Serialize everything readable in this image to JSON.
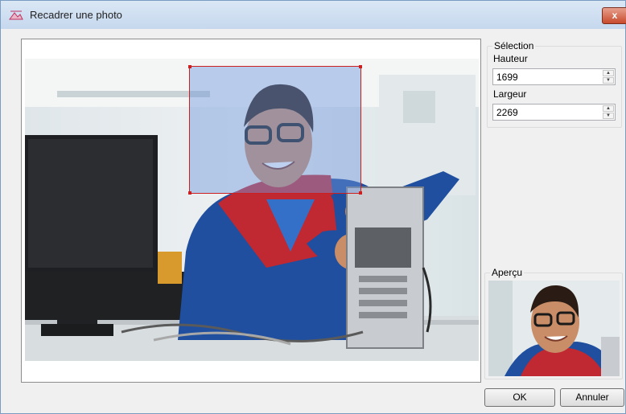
{
  "window": {
    "title": "Recadrer une photo",
    "close_glyph": "x"
  },
  "selection": {
    "legend": "Sélection",
    "height_label": "Hauteur",
    "height_value": "1699",
    "width_label": "Largeur",
    "width_value": "2269",
    "spin_up_glyph": "▲",
    "spin_down_glyph": "▼"
  },
  "preview": {
    "legend": "Aperçu"
  },
  "buttons": {
    "ok": "OK",
    "cancel": "Annuler"
  },
  "colors": {
    "crop_border": "#cc2020",
    "crop_fill": "#6e96dc",
    "title_bar": "#c6d8ee"
  },
  "icons": {
    "title": "crop-photo-icon"
  }
}
